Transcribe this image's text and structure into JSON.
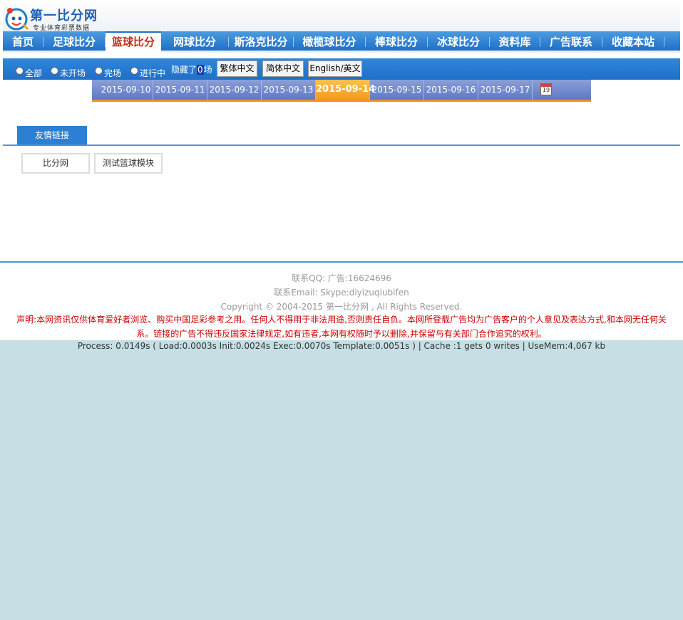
{
  "header": {
    "logo_title": "第一比分网",
    "logo_subtitle": "专业体育彩票数据"
  },
  "nav": {
    "items": [
      {
        "label": "首页",
        "active": false
      },
      {
        "label": "足球比分",
        "active": false
      },
      {
        "label": "篮球比分",
        "active": true
      },
      {
        "label": "网球比分",
        "active": false
      },
      {
        "label": "斯洛克比分",
        "active": false
      },
      {
        "label": "橄榄球比分",
        "active": false
      },
      {
        "label": "棒球比分",
        "active": false
      },
      {
        "label": "冰球比分",
        "active": false
      },
      {
        "label": "资料库",
        "active": false
      },
      {
        "label": "广告联系",
        "active": false
      },
      {
        "label": "收藏本站",
        "active": false
      }
    ]
  },
  "filter": {
    "radios": [
      "全部",
      "未开场",
      "完场",
      "进行中"
    ],
    "hidden_prefix": "隐藏了",
    "hidden_count": "0",
    "hidden_suffix": "场",
    "buttons": [
      "繁体中文",
      "简体中文",
      "English/英文"
    ]
  },
  "dates": {
    "items": [
      "2015-09-10",
      "2015-09-11",
      "2015-09-12",
      "2015-09-13",
      "2015-09-14",
      "2015-09-15",
      "2015-09-16",
      "2015-09-17"
    ],
    "active_index": 4,
    "calendar_day": "19",
    "calendar_icon": "calendar-icon"
  },
  "links": {
    "tab_label": "友情链接",
    "items": [
      "比分网",
      "测试篮球模块"
    ]
  },
  "footer": {
    "qq": "联系QQ:   广告:16624696",
    "email": "联系Email:   Skype:diyizuqiubifen",
    "copyright": "Copyright © 2004-2015 第一比分网 , All Rights Reserved.",
    "disclaimer_line1": "声明:本网资讯仅供体育爱好者浏览、购买中国足彩参考之用。任何人不得用于非法用途,否则责任自负。本网所登载广告均为广告客户的个人意见及表达方式,和本网无任何关",
    "disclaimer_line2": "系。链接的广告不得违反国家法律规定,如有违者,本网有权随时予以删除,并保留与有关部门合作追究的权利。",
    "process": "Process: 0.0149s ( Load:0.0003s Init:0.0024s Exec:0.0070s Template:0.0051s ) | Cache :1 gets 0 writes | UseMem:4,067 kb"
  },
  "colors": {
    "nav_blue": "#1f6fc7",
    "active_red": "#c0301c",
    "date_active": "#f49a1f",
    "disclaimer_red": "#cc0000",
    "bottom_bg": "#c5dfe4"
  }
}
